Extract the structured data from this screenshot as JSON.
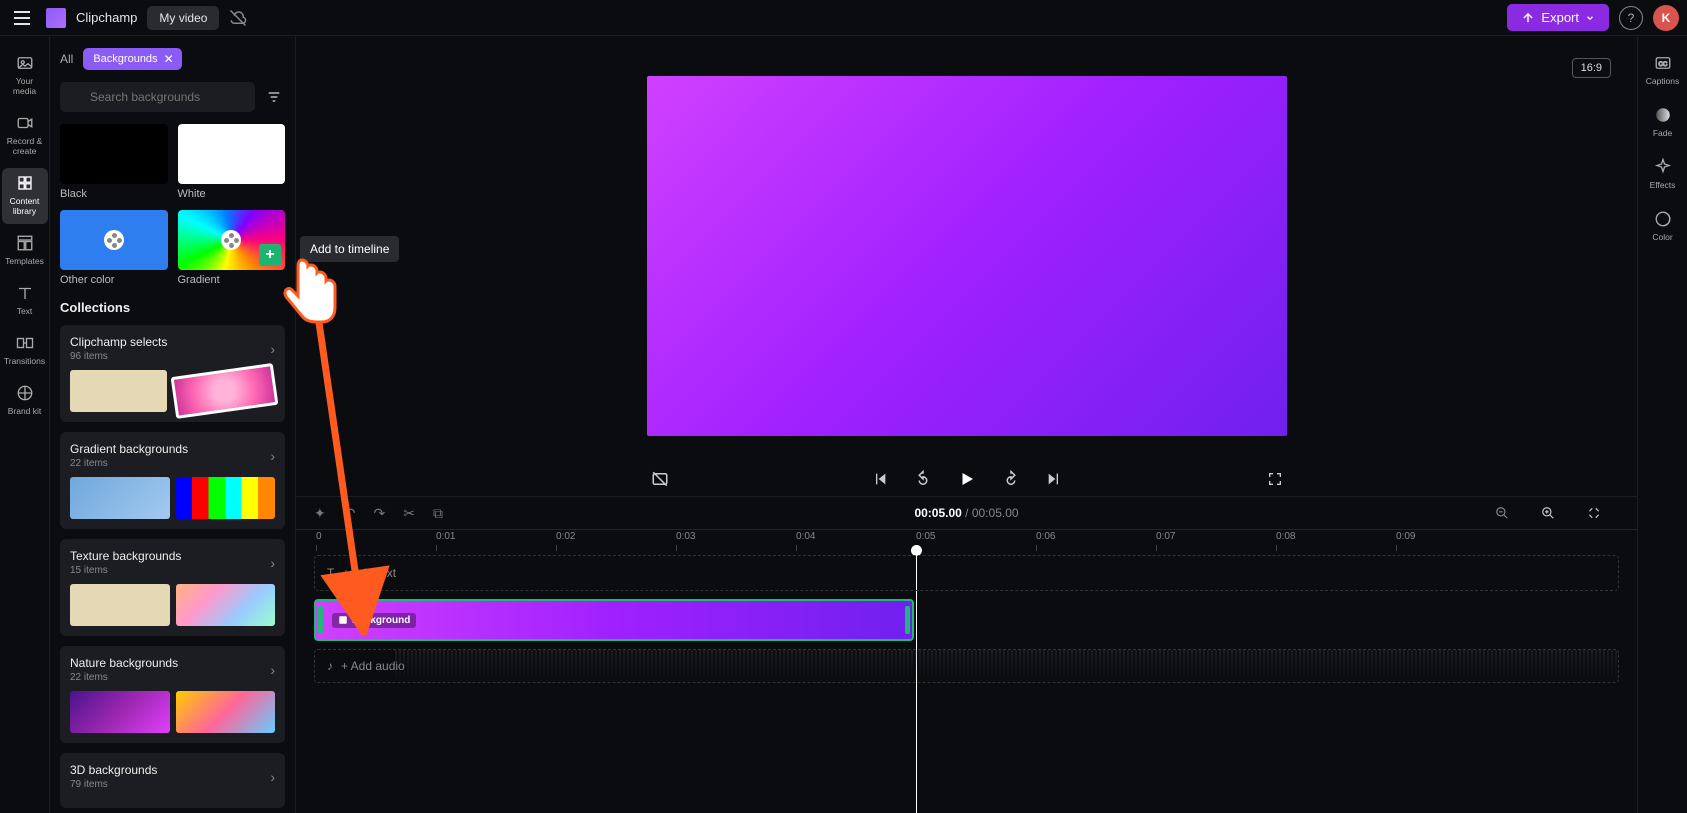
{
  "app": {
    "name": "Clipchamp",
    "project": "My video"
  },
  "export": {
    "label": "Export"
  },
  "avatar": {
    "initial": "K"
  },
  "leftnav": [
    {
      "id": "your-media",
      "label": "Your media"
    },
    {
      "id": "record-create",
      "label": "Record & create"
    },
    {
      "id": "content-library",
      "label": "Content library",
      "active": true
    },
    {
      "id": "templates",
      "label": "Templates"
    },
    {
      "id": "text",
      "label": "Text"
    },
    {
      "id": "transitions",
      "label": "Transitions"
    },
    {
      "id": "brand-kit",
      "label": "Brand kit"
    }
  ],
  "rightnav": [
    {
      "id": "captions",
      "label": "Captions"
    },
    {
      "id": "fade",
      "label": "Fade"
    },
    {
      "id": "effects",
      "label": "Effects"
    },
    {
      "id": "color",
      "label": "Color"
    }
  ],
  "tabs": {
    "all": "All",
    "chip": "Backgrounds"
  },
  "search": {
    "placeholder": "Search backgrounds"
  },
  "backgrounds": {
    "black": "Black",
    "white": "White",
    "other": "Other color",
    "gradient": "Gradient"
  },
  "tooltip": "Add to timeline",
  "collections_header": "Collections",
  "collections": [
    {
      "title": "Clipchamp selects",
      "count": "96 items"
    },
    {
      "title": "Gradient backgrounds",
      "count": "22 items"
    },
    {
      "title": "Texture backgrounds",
      "count": "15 items"
    },
    {
      "title": "Nature backgrounds",
      "count": "22 items"
    },
    {
      "title": "3D backgrounds",
      "count": "79 items"
    }
  ],
  "aspect": "16:9",
  "time": {
    "current": "00:05.00",
    "total": "00:05.00"
  },
  "ruler": [
    "0",
    "0:01",
    "0:02",
    "0:03",
    "0:04",
    "0:05",
    "0:06",
    "0:07",
    "0:08",
    "0:09"
  ],
  "tracks": {
    "text_prompt": "+ Add text",
    "audio_prompt": "+ Add audio",
    "clip_label": "Background"
  }
}
